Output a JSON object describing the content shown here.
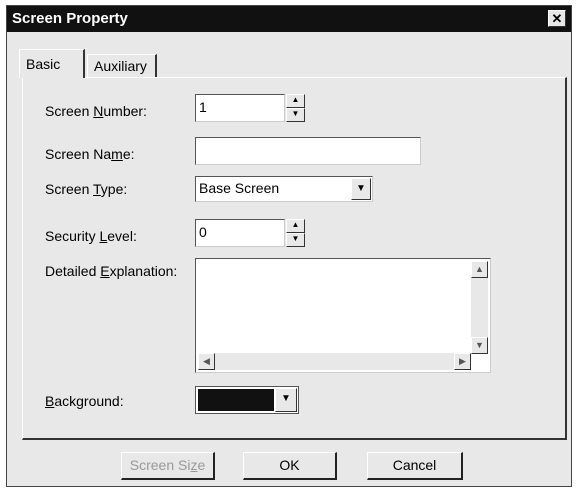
{
  "window": {
    "title": "Screen Property",
    "close_glyph": "✕"
  },
  "tabs": [
    {
      "label": "Basic"
    },
    {
      "label": "Auxiliary"
    }
  ],
  "form": {
    "screen_number": {
      "label_pre": "Screen ",
      "label_key": "N",
      "label_post": "umber:",
      "value": "1"
    },
    "screen_name": {
      "label_pre": "Screen Na",
      "label_key": "m",
      "label_post": "e:",
      "value": ""
    },
    "screen_type": {
      "label_pre": "Screen ",
      "label_key": "T",
      "label_post": "ype:",
      "value": "Base Screen"
    },
    "security_level": {
      "label_pre": "Security ",
      "label_key": "L",
      "label_post": "evel:",
      "value": "0"
    },
    "detailed_explanation": {
      "label_pre": "Detailed ",
      "label_key": "E",
      "label_post": "xplanation:",
      "value": ""
    },
    "background": {
      "label_pre": "",
      "label_key": "B",
      "label_post": "ackground:",
      "color": "#111111"
    }
  },
  "buttons": {
    "screen_size": {
      "pre": "Screen Si",
      "key": "z",
      "post": "e"
    },
    "ok": "OK",
    "cancel": "Cancel"
  },
  "icons": {
    "spin_up": "▲",
    "spin_down": "▼",
    "dropdown": "▼",
    "scroll_up": "▲",
    "scroll_down": "▼",
    "scroll_left": "◀",
    "scroll_right": "▶"
  }
}
